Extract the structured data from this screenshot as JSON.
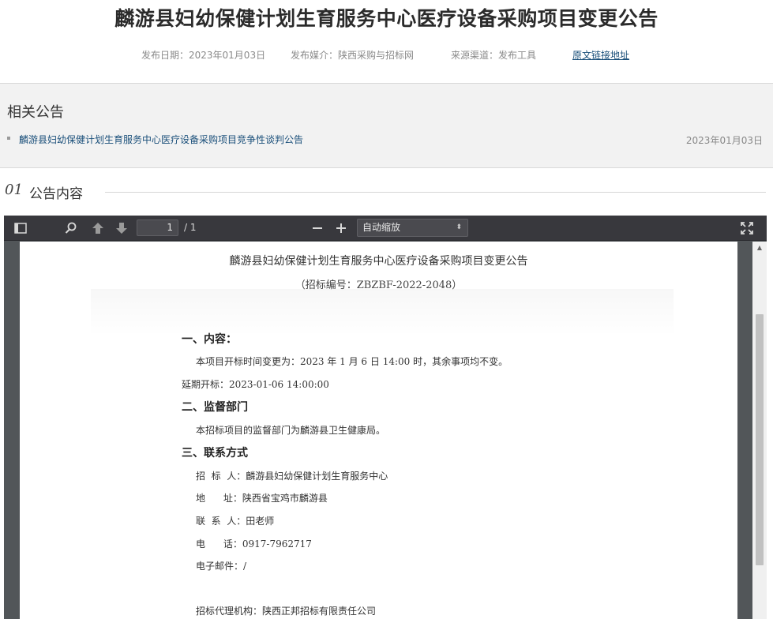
{
  "header": {
    "title": "麟游县妇幼保健计划生育服务中心医疗设备采购项目变更公告",
    "publish_date": "发布日期：2023年01月03日",
    "publish_media": "发布媒介：陕西采购与招标网",
    "source_channel": "来源渠道：发布工具",
    "original_link": "原文链接地址"
  },
  "related": {
    "title": "相关公告",
    "items": [
      {
        "label": "麟游县妇幼保健计划生育服务中心医疗设备采购项目竞争性谈判公告",
        "date": "2023年01月03日"
      }
    ]
  },
  "section": {
    "number": "01",
    "title": "公告内容"
  },
  "viewer": {
    "toolbar": {
      "page_current": "1",
      "page_total": "/ 1",
      "zoom": "自动缩放",
      "icons": [
        "sidebar-toggle-icon",
        "search-icon",
        "previous-page-icon",
        "next-page-icon",
        "zoom-out-icon",
        "zoom-in-icon",
        "fullscreen-icon"
      ]
    },
    "document": {
      "title": "麟游县妇幼保健计划生育服务中心医疗设备采购项目变更公告",
      "subtitle": "（招标编号：ZBZBF-2022-2048）",
      "h1": "一、内容：",
      "content_line": "本项目开标时间变更为：2023 年 1 月 6 日 14:00 时，其余事项均不变。",
      "delay_line": "延期开标：2023-01-06 14:00:00",
      "h2": "二、监督部门",
      "supervision_line": "本招标项目的监督部门为麟游县卫生健康局。",
      "h3": "三、联系方式",
      "contact": {
        "tenderer": "招  标  人：麟游县妇幼保健计划生育服务中心",
        "address": "地      址：陕西省宝鸡市麟游县",
        "contact_person": "联  系  人：田老师",
        "phone": "电      话：0917-7962717",
        "email": "电子邮件：/",
        "agency": "招标代理机构：陕西正邦招标有限责任公司"
      }
    }
  }
}
